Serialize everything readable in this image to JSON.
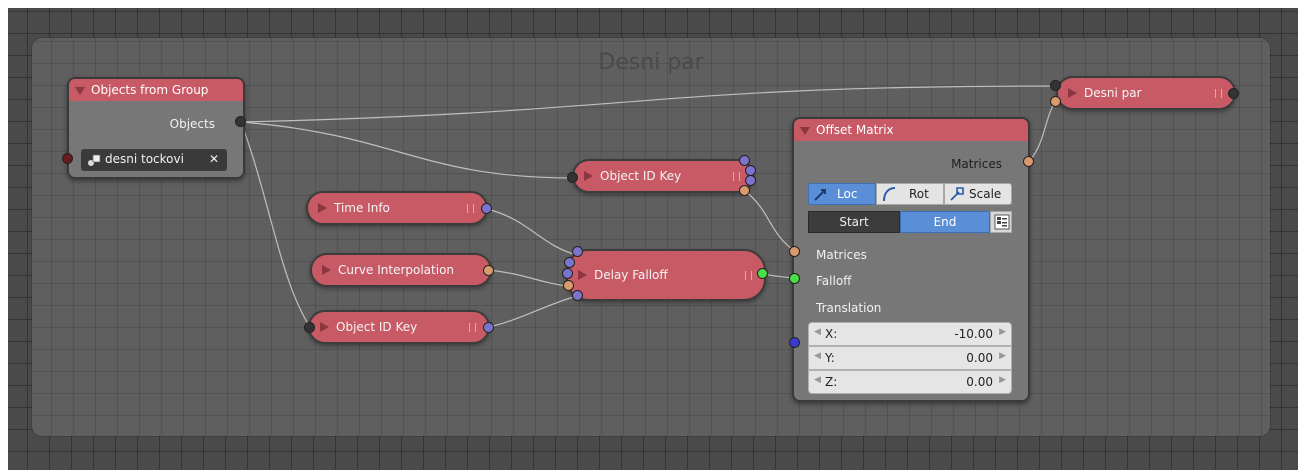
{
  "frame": {
    "label": "Desni par"
  },
  "nodes": {
    "objects_from_group": {
      "title": "Objects from Group",
      "output_label": "Objects",
      "group_name": "desni  tockovi",
      "clear_glyph": "✕"
    },
    "object_id_key_top": {
      "label": "Object ID Key"
    },
    "time_info": {
      "label": "Time Info"
    },
    "curve_interpolation": {
      "label": "Curve Interpolation"
    },
    "object_id_key_bottom": {
      "label": "Object ID Key"
    },
    "delay_falloff": {
      "label": "Delay Falloff"
    },
    "desni_par": {
      "label": "Desni par"
    },
    "offset_matrix": {
      "title": "Offset Matrix",
      "output_label": "Matrices",
      "mode_buttons": [
        "Loc",
        "Rot",
        "Scale"
      ],
      "active_mode": "Loc",
      "range_buttons": [
        "Start",
        "End"
      ],
      "active_range": "End",
      "inputs": {
        "matrices": "Matrices",
        "falloff": "Falloff",
        "translation": "Translation"
      },
      "translation": [
        {
          "axis": "X:",
          "value": "-10.00"
        },
        {
          "axis": "Y:",
          "value": "0.00"
        },
        {
          "axis": "Z:",
          "value": "0.00"
        }
      ]
    }
  },
  "colors": {
    "node_header": "#c85a66",
    "accent_blue": "#5a8fd8",
    "socket_object": "#333333",
    "socket_matrix": "#d99a6c",
    "socket_integer": "#7c74cc",
    "socket_float": "#48e048",
    "socket_vector": "#3a3ad0"
  },
  "icons": [
    "collapse-arrow-icon",
    "object-group-icon",
    "close-icon",
    "loc-icon",
    "rot-icon",
    "scale-icon",
    "list-settings-icon",
    "node-options-icon"
  ]
}
